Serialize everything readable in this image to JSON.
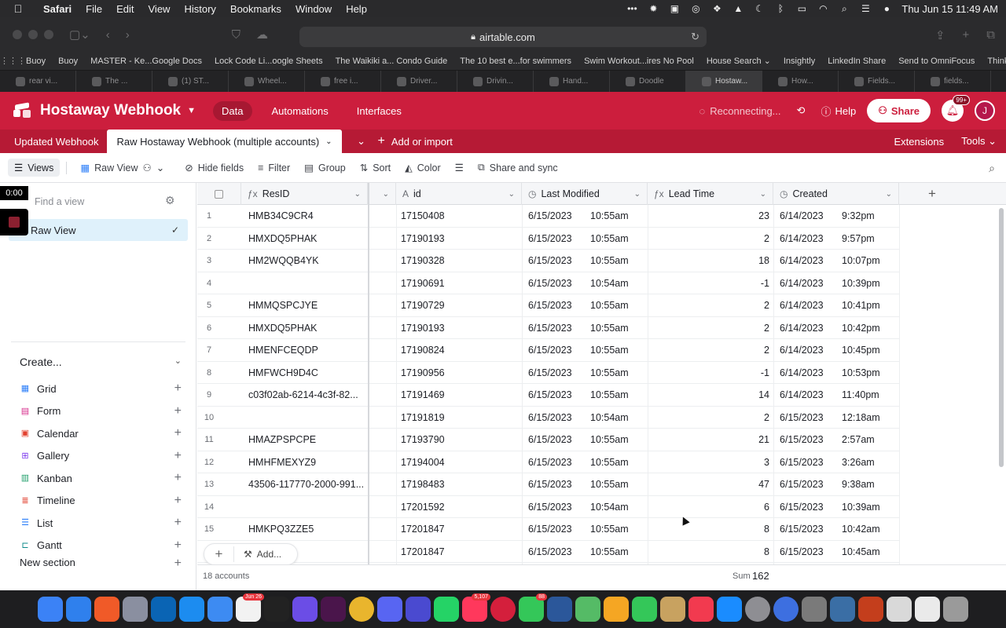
{
  "menubar": {
    "app": "Safari",
    "items": [
      "File",
      "Edit",
      "View",
      "History",
      "Bookmarks",
      "Window",
      "Help"
    ],
    "status_icons": [
      "more-icon",
      "sun-icon",
      "calendar-icon",
      "cast-icon",
      "dropbox-icon",
      "app-icon",
      "moon-icon",
      "bluetooth-icon",
      "battery-icon",
      "wifi-icon",
      "search-icon",
      "control-center-icon",
      "siri-icon"
    ],
    "clock": "Thu Jun 15  11:49 AM"
  },
  "browser": {
    "url": "airtable.com",
    "favorites": [
      "Buoy",
      "Buoy",
      "MASTER - Ke...Google Docs",
      "Lock Code Li...oogle Sheets",
      "The Waikiki a... Condo Guide",
      "The 10 best e...for swimmers",
      "Swim Workout...ires No Pool",
      "House Search ⌄",
      "Insightly",
      "LinkedIn Share",
      "Send to OmniFocus",
      "ThinkCentral"
    ],
    "tabs": [
      "rear vi...",
      "The ...",
      "(1) ST...",
      "Wheel...",
      "free i...",
      "Driver...",
      "Drivin...",
      "Hand...",
      "Doodle",
      "Hostaw...",
      "How...",
      "Fields...",
      "fields..."
    ],
    "active_tab_index": 9
  },
  "app": {
    "base_name": "Hostaway Webhook",
    "nav": [
      "Data",
      "Automations",
      "Interfaces"
    ],
    "status": "Reconnecting...",
    "help": "Help",
    "share": "Share",
    "notif_badge": "99+",
    "avatar": "J",
    "brand_color": "#cc1e3d"
  },
  "tables": {
    "items": [
      "Updated Webhook",
      "Raw Hostaway Webhook (multiple accounts)"
    ],
    "add": "Add or import",
    "extensions": "Extensions",
    "tools": "Tools"
  },
  "viewbar": {
    "views": "Views",
    "current_view": "Raw View",
    "hide_fields": "Hide fields",
    "filter": "Filter",
    "group": "Group",
    "sort": "Sort",
    "color": "Color",
    "share_sync": "Share and sync"
  },
  "sidebar": {
    "find_placeholder": "Find a view",
    "active_view": "Raw View",
    "create": "Create...",
    "create_items": [
      {
        "label": "Grid",
        "color": "#2d7ff9"
      },
      {
        "label": "Form",
        "color": "#d62b8b"
      },
      {
        "label": "Calendar",
        "color": "#e2412f"
      },
      {
        "label": "Gallery",
        "color": "#7c39ed"
      },
      {
        "label": "Kanban",
        "color": "#1f9e6a"
      },
      {
        "label": "Timeline",
        "color": "#e2412f"
      },
      {
        "label": "List",
        "color": "#2d7ff9"
      },
      {
        "label": "Gantt",
        "color": "#0b8a8a"
      }
    ],
    "new_section": "New section"
  },
  "grid": {
    "columns": [
      "ResID",
      "id",
      "Last Modified",
      "Lead Time",
      "Created"
    ],
    "rows": [
      {
        "n": "1",
        "resid": "HMB34C9CR4",
        "id": "17150408",
        "lm_date": "6/15/2023",
        "lm_time": "10:55am",
        "lead": "23",
        "c_date": "6/14/2023",
        "c_time": "9:32pm"
      },
      {
        "n": "2",
        "resid": "HMXDQ5PHAK",
        "id": "17190193",
        "lm_date": "6/15/2023",
        "lm_time": "10:55am",
        "lead": "2",
        "c_date": "6/14/2023",
        "c_time": "9:57pm"
      },
      {
        "n": "3",
        "resid": "HM2WQQB4YK",
        "id": "17190328",
        "lm_date": "6/15/2023",
        "lm_time": "10:55am",
        "lead": "18",
        "c_date": "6/14/2023",
        "c_time": "10:07pm"
      },
      {
        "n": "4",
        "resid": "",
        "id": "17190691",
        "lm_date": "6/15/2023",
        "lm_time": "10:54am",
        "lead": "-1",
        "c_date": "6/14/2023",
        "c_time": "10:39pm"
      },
      {
        "n": "5",
        "resid": "HMMQSPCJYE",
        "id": "17190729",
        "lm_date": "6/15/2023",
        "lm_time": "10:55am",
        "lead": "2",
        "c_date": "6/14/2023",
        "c_time": "10:41pm"
      },
      {
        "n": "6",
        "resid": "HMXDQ5PHAK",
        "id": "17190193",
        "lm_date": "6/15/2023",
        "lm_time": "10:55am",
        "lead": "2",
        "c_date": "6/14/2023",
        "c_time": "10:42pm"
      },
      {
        "n": "7",
        "resid": "HMENFCEQDP",
        "id": "17190824",
        "lm_date": "6/15/2023",
        "lm_time": "10:55am",
        "lead": "2",
        "c_date": "6/14/2023",
        "c_time": "10:45pm"
      },
      {
        "n": "8",
        "resid": "HMFWCH9D4C",
        "id": "17190956",
        "lm_date": "6/15/2023",
        "lm_time": "10:55am",
        "lead": "-1",
        "c_date": "6/14/2023",
        "c_time": "10:53pm"
      },
      {
        "n": "9",
        "resid": "c03f02ab-6214-4c3f-82...",
        "id": "17191469",
        "lm_date": "6/15/2023",
        "lm_time": "10:55am",
        "lead": "14",
        "c_date": "6/14/2023",
        "c_time": "11:40pm"
      },
      {
        "n": "10",
        "resid": "",
        "id": "17191819",
        "lm_date": "6/15/2023",
        "lm_time": "10:54am",
        "lead": "2",
        "c_date": "6/15/2023",
        "c_time": "12:18am"
      },
      {
        "n": "11",
        "resid": "HMAZPSPCPE",
        "id": "17193790",
        "lm_date": "6/15/2023",
        "lm_time": "10:55am",
        "lead": "21",
        "c_date": "6/15/2023",
        "c_time": "2:57am"
      },
      {
        "n": "12",
        "resid": "HMHFMEXYZ9",
        "id": "17194004",
        "lm_date": "6/15/2023",
        "lm_time": "10:55am",
        "lead": "3",
        "c_date": "6/15/2023",
        "c_time": "3:26am"
      },
      {
        "n": "13",
        "resid": "43506-117770-2000-991...",
        "id": "17198483",
        "lm_date": "6/15/2023",
        "lm_time": "10:55am",
        "lead": "47",
        "c_date": "6/15/2023",
        "c_time": "9:38am"
      },
      {
        "n": "14",
        "resid": "",
        "id": "17201592",
        "lm_date": "6/15/2023",
        "lm_time": "10:54am",
        "lead": "6",
        "c_date": "6/15/2023",
        "c_time": "10:39am"
      },
      {
        "n": "15",
        "resid": "HMKPQ3ZZE5",
        "id": "17201847",
        "lm_date": "6/15/2023",
        "lm_time": "10:55am",
        "lead": "8",
        "c_date": "6/15/2023",
        "c_time": "10:42am"
      },
      {
        "n": "",
        "resid": "ZE5",
        "id": "17201847",
        "lm_date": "6/15/2023",
        "lm_time": "10:55am",
        "lead": "8",
        "c_date": "6/15/2023",
        "c_time": "10:45am"
      }
    ],
    "record_count": "18 accounts",
    "sum_label": "Sum",
    "sum_value": "162",
    "add_label": "Add..."
  },
  "recorder": {
    "time": "0:00"
  },
  "dock": {
    "icons": [
      "finder-icon",
      "safari-icon",
      "brave-icon",
      "launchpad-icon",
      "outlook-icon",
      "testflight-icon",
      "mail-icon",
      "calendar-icon",
      "threads-icon",
      "omnifocus-icon",
      "slack-icon",
      "chrome-icon",
      "discord-icon",
      "app-icon",
      "whatsapp-icon",
      "airbnb-icon",
      "dots-icon",
      "messages-icon",
      "word-icon",
      "maps-icon",
      "photos-icon",
      "facetime-icon",
      "notes-icon",
      "news-icon",
      "appstore-icon",
      "settings-icon",
      "spark-icon",
      "calculator-icon",
      "preview-icon",
      "powerpoint-icon",
      "image-icon",
      "file-icon",
      "trash-icon"
    ],
    "badges": {
      "calendar-icon": "Jun 26",
      "airbnb-icon": "5,107",
      "messages-icon": "88"
    }
  }
}
